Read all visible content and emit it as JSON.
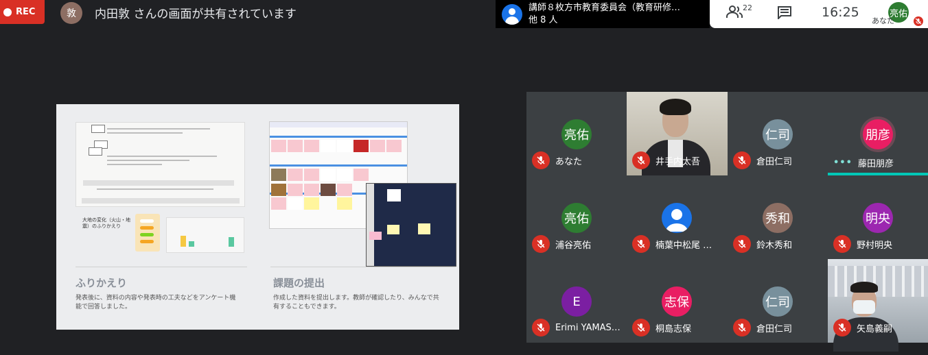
{
  "top_bar": {
    "rec_label": "REC",
    "presenter_initial": "敦",
    "presenter_text": "内田敦 さんの画面が共有されています"
  },
  "meeting": {
    "title": "講師８枚方市教育委員会（教育研修…",
    "others": "他 8 人"
  },
  "status": {
    "people_count": "22",
    "time": "16:25",
    "self_initials": "亮佑",
    "self_label": "あなた"
  },
  "slide": {
    "left_heading": "ふりかえり",
    "left_desc_1": "発表後に、資料の内容や発表時の工夫などをアンケート機",
    "left_desc_2": "能で回答しました。",
    "right_heading": "課題の提出",
    "right_desc_1": "作成した資料を提出します。教師が確認したり、みんなで共",
    "right_desc_2": "有することもできます。",
    "sub_title": "大地の変化（火山・地震）のふりかえり"
  },
  "participants": [
    {
      "initials": "亮佑",
      "name": "あなた",
      "color": "#2e7d32",
      "video": false
    },
    {
      "initials": "",
      "name": "井手内太吾",
      "color": "",
      "video": true
    },
    {
      "initials": "仁司",
      "name": "倉田仁司",
      "color": "#78909c",
      "video": false
    },
    {
      "initials": "朋彦",
      "name": "藤田朋彦",
      "color": "#e91e63",
      "video": false,
      "speaking": true
    },
    {
      "initials": "亮佑",
      "name": "浦谷亮佑",
      "color": "#2e7d32",
      "video": false
    },
    {
      "initials": "",
      "name": "楠葉中松尾 …",
      "color": "#1a73e8",
      "video": false,
      "generic_avatar": true
    },
    {
      "initials": "秀和",
      "name": "鈴木秀和",
      "color": "#8d6e63",
      "video": false
    },
    {
      "initials": "明央",
      "name": "野村明央",
      "color": "#9c27b0",
      "video": false
    },
    {
      "initials": "E",
      "name": "Erimi YAMAS…",
      "color": "#7b1fa2",
      "video": false
    },
    {
      "initials": "志保",
      "name": "桐島志保",
      "color": "#e91e63",
      "video": false
    },
    {
      "initials": "仁司",
      "name": "倉田仁司",
      "color": "#78909c",
      "video": false
    },
    {
      "initials": "",
      "name": "矢島義嗣",
      "color": "",
      "video": true
    }
  ]
}
